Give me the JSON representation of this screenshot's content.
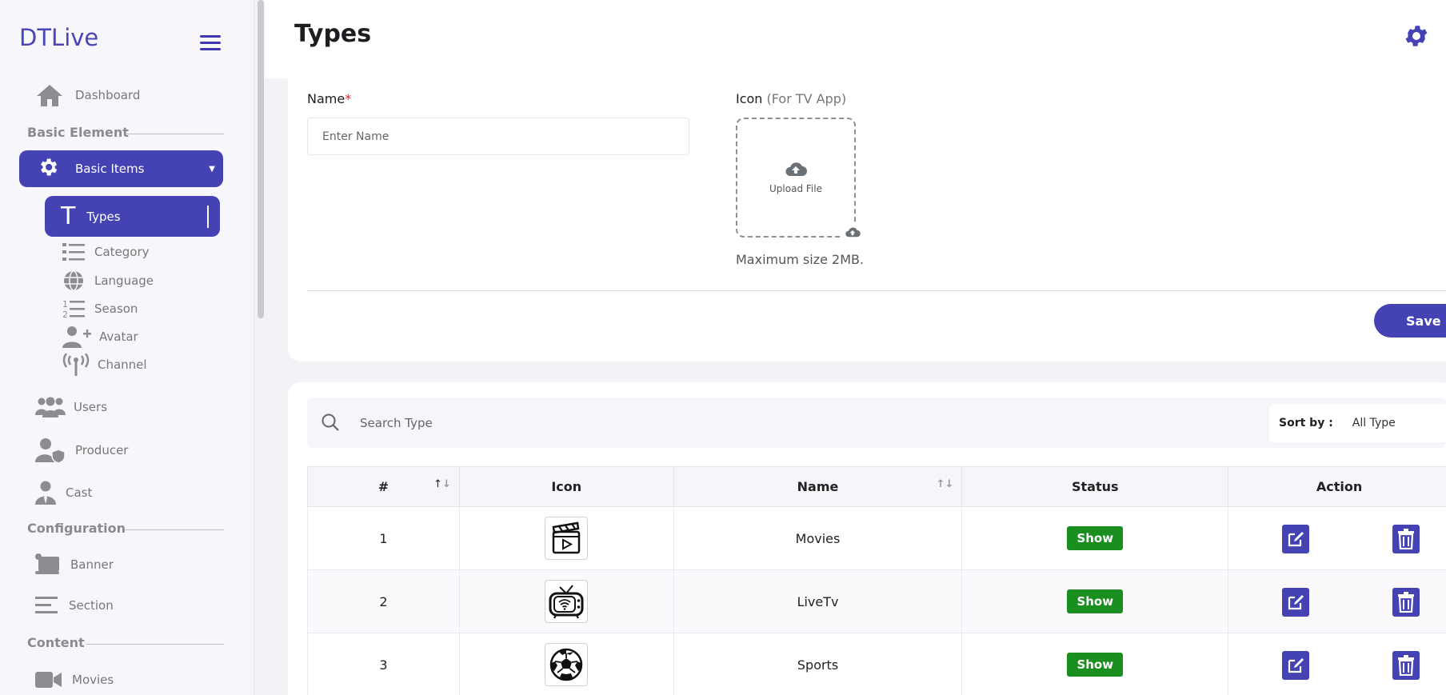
{
  "app": {
    "logo": "DTLive"
  },
  "sidebar": {
    "dashboard": "Dashboard",
    "section_basic": "Basic Element",
    "basic_items": "Basic Items",
    "sub": {
      "types": "Types",
      "category": "Category",
      "language": "Language",
      "season": "Season",
      "avatar": "Avatar",
      "channel": "Channel"
    },
    "users": "Users",
    "producer": "Producer",
    "cast": "Cast",
    "section_config": "Configuration",
    "banner": "Banner",
    "section": "Section",
    "section_content": "Content",
    "movies": "Movies"
  },
  "page": {
    "title": "Types"
  },
  "form": {
    "name_label": "Name",
    "required_mark": "*",
    "name_placeholder": "Enter Name",
    "icon_label": "Icon",
    "icon_hint": "(For TV App)",
    "upload_text": "Upload File",
    "max_size": "Maximum size 2MB.",
    "save": "Save"
  },
  "list": {
    "search_placeholder": "Search Type",
    "sort_label": "Sort by :",
    "sort_value": "All Type",
    "columns": [
      "#",
      "Icon",
      "Name",
      "Status",
      "Action"
    ],
    "rows": [
      {
        "num": "1",
        "icon": "clapperboard-icon",
        "name": "Movies",
        "status": "Show"
      },
      {
        "num": "2",
        "icon": "tv-icon",
        "name": "LiveTv",
        "status": "Show"
      },
      {
        "num": "3",
        "icon": "soccer-ball-icon",
        "name": "Sports",
        "status": "Show"
      }
    ]
  },
  "colors": {
    "primary": "#4542b4",
    "status_show": "#1a8f1f",
    "required": "#ee2222"
  }
}
